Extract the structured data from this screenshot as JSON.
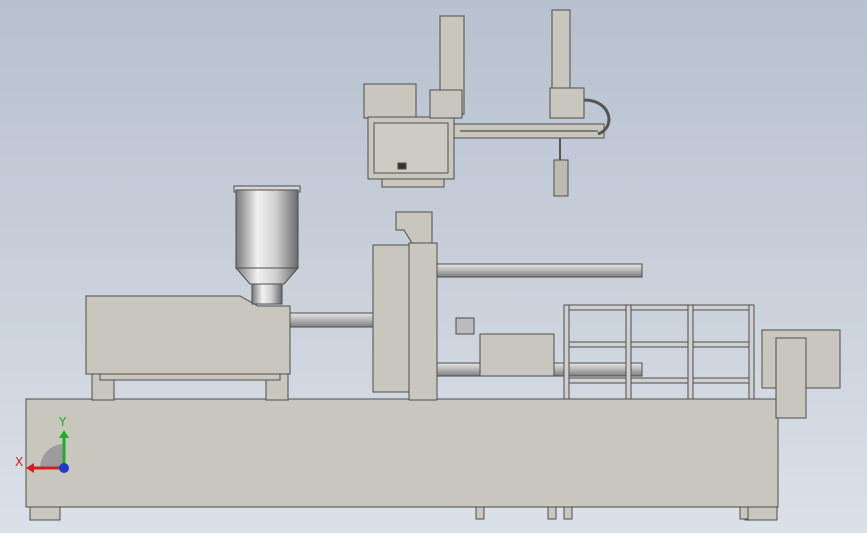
{
  "view": {
    "type": "cad-3d-viewport",
    "scene": "injection-molding-machine-with-gantry-robot",
    "background_top": "#b7c1cf",
    "background_bottom": "#dbe1e8"
  },
  "triad": {
    "x_label": "X",
    "y_label": "Y",
    "x_color": "#d21e1e",
    "y_color": "#1fae2a",
    "z_color": "#1a3cc8"
  },
  "colors": {
    "machine_body": "#c9c6bd",
    "machine_edge": "#4d4d4d",
    "chrome_light": "#eeeeee",
    "chrome_dark": "#6f6f6f"
  }
}
